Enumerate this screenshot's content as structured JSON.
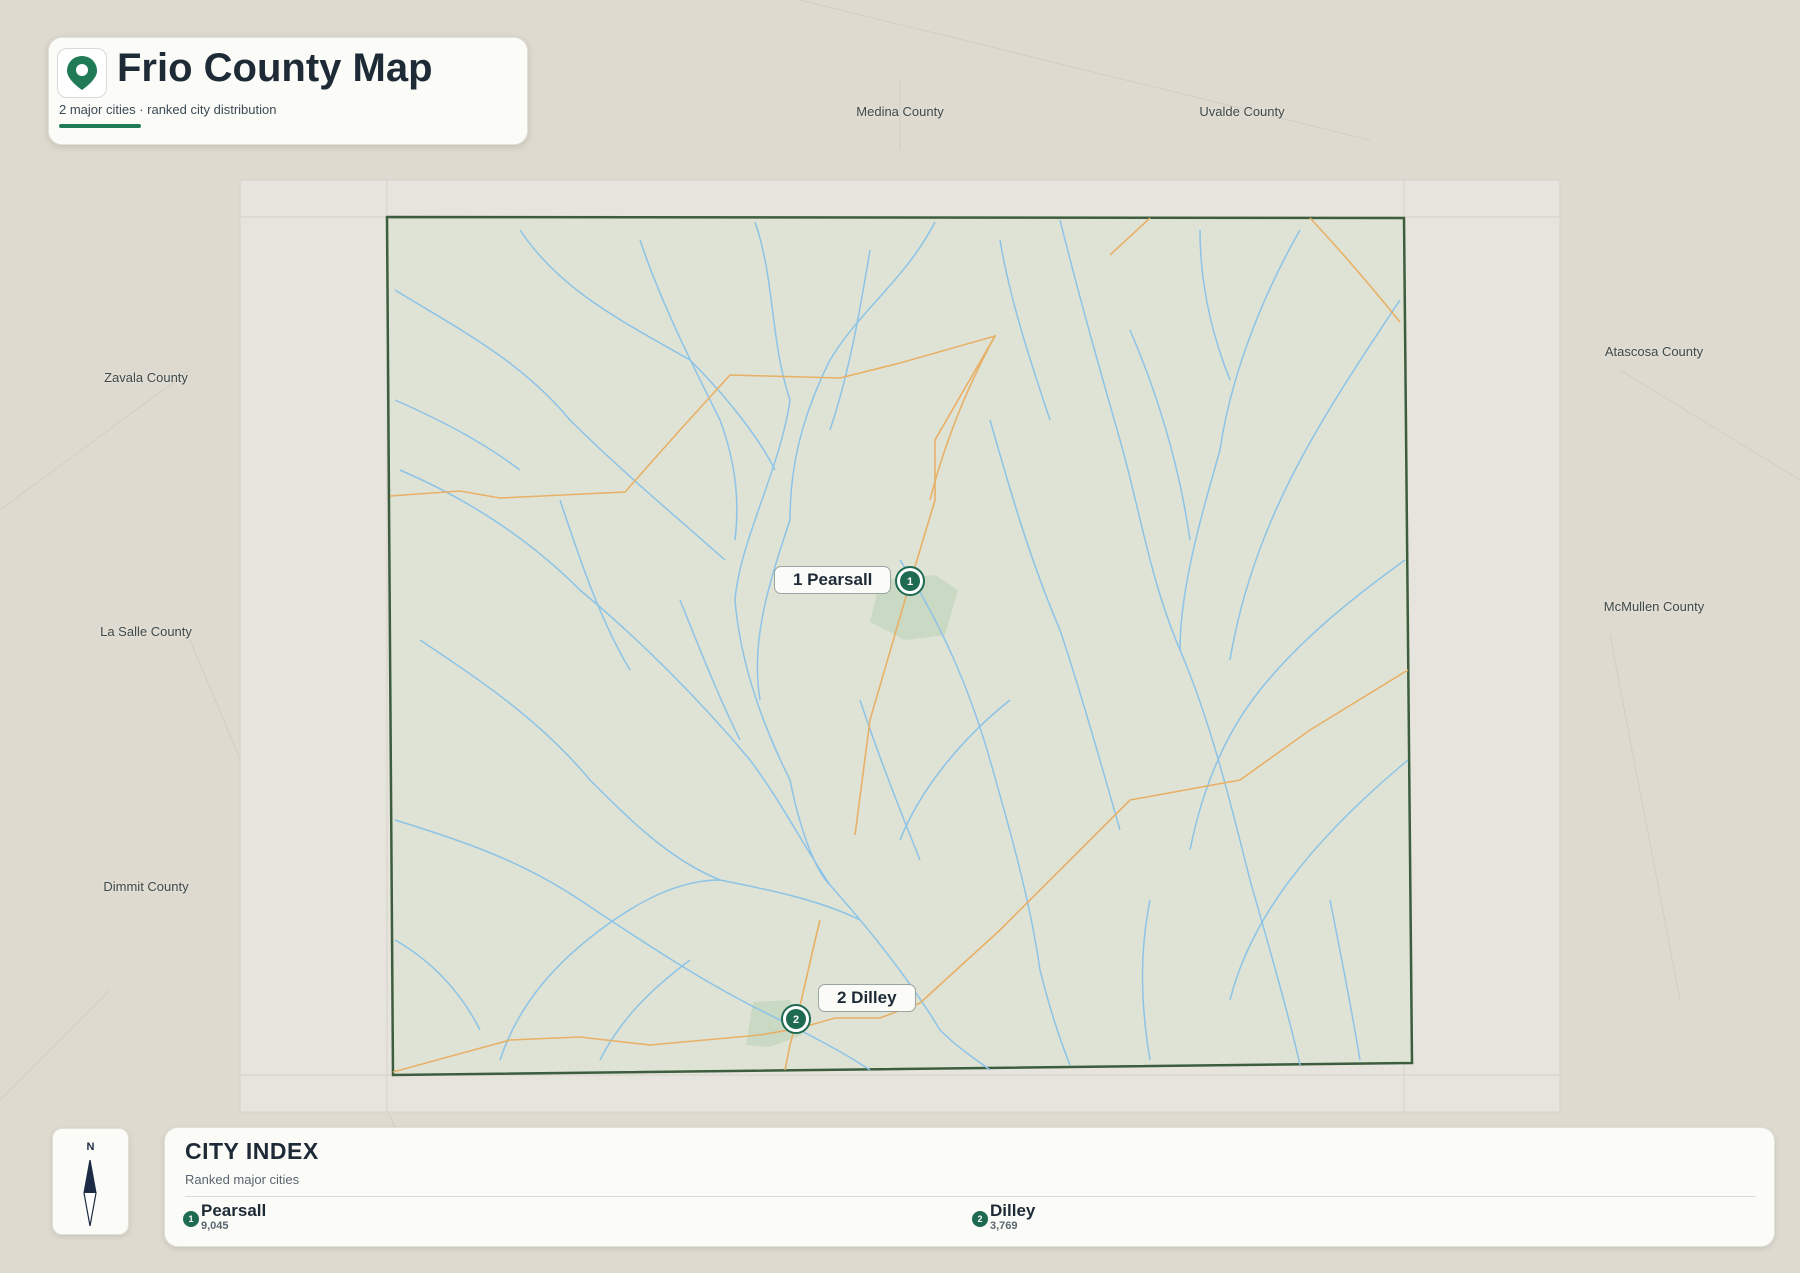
{
  "header": {
    "title": "Frio County Map",
    "subtitle": "2 major cities · ranked city distribution"
  },
  "neighbor_counties": [
    {
      "name": "Medina County"
    },
    {
      "name": "Uvalde County"
    },
    {
      "name": "Atascosa County"
    },
    {
      "name": "Zavala County"
    },
    {
      "name": "La Salle County"
    },
    {
      "name": "McMullen County"
    },
    {
      "name": "Dimmit County"
    }
  ],
  "cities": [
    {
      "rank": "1",
      "name": "Pearsall",
      "map_label": "1 Pearsall",
      "population": "9,045"
    },
    {
      "rank": "2",
      "name": "Dilley",
      "map_label": "2 Dilley",
      "population": "3,769"
    }
  ],
  "compass": {
    "north": "N"
  },
  "city_index": {
    "title": "CITY INDEX",
    "subtitle": "Ranked major cities"
  },
  "colors": {
    "county_fill": "#dfe3d6",
    "border": "#3c5e3e",
    "rivers": "#8cc3e6",
    "roads": "#e8b066",
    "marker": "#1f6b52",
    "accent": "#1f7a55"
  },
  "icons": {
    "title": "map-pin-icon",
    "compass": "compass-needle-icon"
  }
}
